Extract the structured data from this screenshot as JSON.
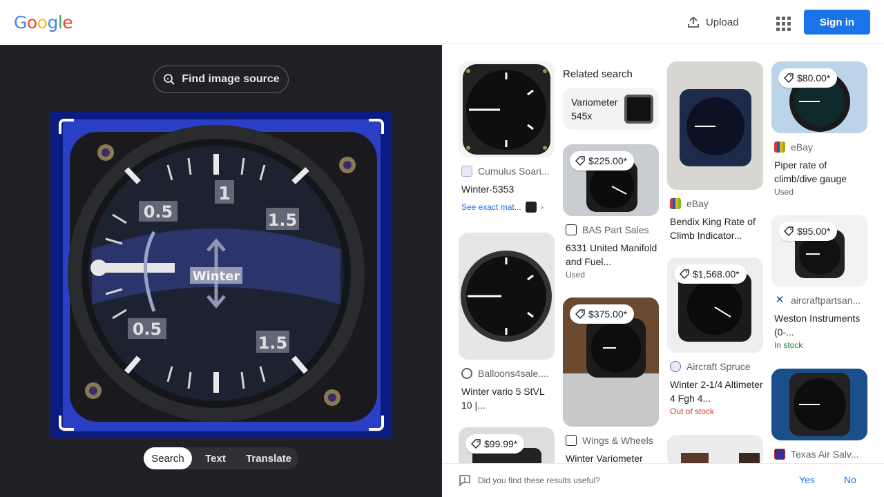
{
  "header": {
    "logo": "Google",
    "upload_label": "Upload",
    "signin_label": "Sign in"
  },
  "left": {
    "find_source_label": "Find image source",
    "tabs": [
      "Search",
      "Text",
      "Translate"
    ],
    "active_tab": "Search"
  },
  "related": {
    "heading": "Related search",
    "chip": "Variometer 545x"
  },
  "results": [
    {
      "source": "Cumulus Soari...",
      "title": "Winter-5353",
      "exact": "See exact mat..."
    },
    {
      "source": "Balloons4sale....",
      "title": "Winter vario 5 StVL 10 |..."
    },
    {
      "price": "$99.99*"
    },
    {
      "price": "$225.00*",
      "source": "BAS Part Sales",
      "title": "6331 United Manifold and Fuel...",
      "status": "Used"
    },
    {
      "price": "$375.00*",
      "source": "Wings & Wheels",
      "title": "Winter Variometer"
    },
    {
      "source": "eBay",
      "title": "Bendix King Rate of Climb Indicator..."
    },
    {
      "price": "$1,568.00*",
      "source": "Aircraft Spruce",
      "title": "Winter 2-1/4 Altimeter 4 Fgh 4...",
      "status": "Out of stock"
    },
    {
      "price": "$80.00*",
      "source": "eBay",
      "title": "Piper rate of climb/dive gauge",
      "status": "Used"
    },
    {
      "price": "$95.00*",
      "source": "aircraftpartsan...",
      "title": "Weston Instruments (0-...",
      "status": "In stock"
    },
    {
      "source": "Texas Air Salv..."
    }
  ],
  "feedback": {
    "question": "Did you find these results useful?",
    "yes": "Yes",
    "no": "No"
  },
  "gauge_labels": [
    "0.5",
    "1",
    "1.5",
    "0.5",
    "1.5",
    "Winter"
  ]
}
